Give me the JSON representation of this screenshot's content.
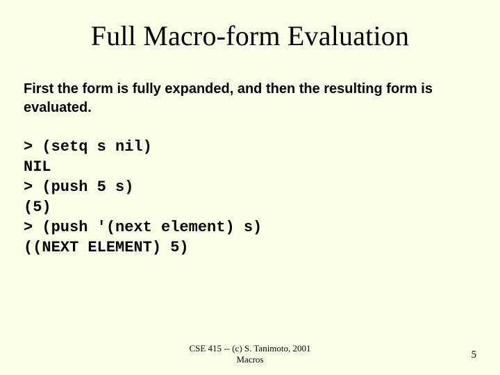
{
  "title": "Full Macro-form Evaluation",
  "subtitle": "First the form is fully expanded, and then the resulting form is evaluated.",
  "code": "> (setq s nil)\nNIL\n> (push 5 s)\n(5)\n> (push '(next element) s)\n((NEXT ELEMENT) 5)",
  "footer_line1": "CSE 415 -- (c) S. Tanimoto, 2001",
  "footer_line2": "Macros",
  "page_number": "5"
}
